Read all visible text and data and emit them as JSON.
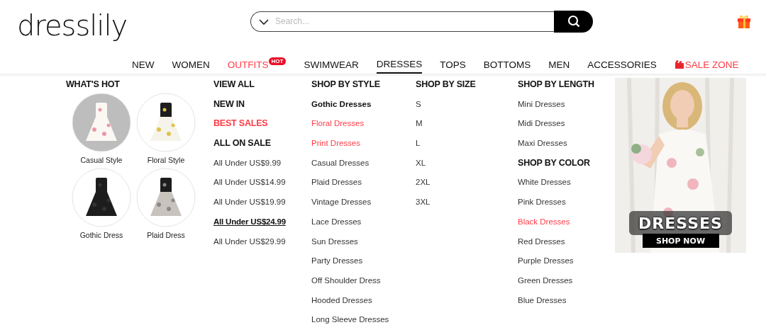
{
  "header": {
    "logo": "dresslily",
    "search": {
      "placeholder": "Search..."
    }
  },
  "nav": [
    {
      "label": "NEW",
      "kind": "plain",
      "selected": false
    },
    {
      "label": "WOMEN",
      "kind": "plain",
      "selected": false
    },
    {
      "label": "OUTFITS",
      "kind": "hot",
      "badge": "HOT",
      "selected": false
    },
    {
      "label": "SWIMWEAR",
      "kind": "plain",
      "selected": false
    },
    {
      "label": "DRESSES",
      "kind": "plain",
      "selected": true
    },
    {
      "label": "TOPS",
      "kind": "plain",
      "selected": false
    },
    {
      "label": "BOTTOMS",
      "kind": "plain",
      "selected": false
    },
    {
      "label": "MEN",
      "kind": "plain",
      "selected": false
    },
    {
      "label": "ACCESSORIES",
      "kind": "plain",
      "selected": false
    },
    {
      "label": "SALE ZONE",
      "kind": "sale",
      "selected": false
    }
  ],
  "whats_hot": {
    "title": "WHAT'S HOT",
    "items": [
      {
        "caption": "Casual Style",
        "kind": "picture"
      },
      {
        "caption": "Floral Style",
        "kind": "picture"
      },
      {
        "caption": "Gothic Dress",
        "kind": "picture"
      },
      {
        "caption": "Plaid Dress",
        "kind": "picture"
      }
    ]
  },
  "columns": [
    {
      "groups": [
        {
          "links": [
            {
              "label": "VIEW ALL",
              "kind": "heading"
            },
            {
              "label": "NEW IN",
              "kind": "heading"
            },
            {
              "label": "BEST SALES",
              "kind": "heading-red"
            },
            {
              "label": "ALL ON SALE",
              "kind": "heading"
            },
            {
              "label": "All Under US$9.99",
              "kind": "normal"
            },
            {
              "label": "All Under US$14.99",
              "kind": "normal"
            },
            {
              "label": "All Under US$19.99",
              "kind": "normal"
            },
            {
              "label": "All Under US$24.99",
              "kind": "underline"
            },
            {
              "label": "All Under US$29.99",
              "kind": "normal"
            }
          ]
        }
      ]
    },
    {
      "groups": [
        {
          "title": "SHOP BY STYLE",
          "links": [
            {
              "label": "Gothic Dresses",
              "kind": "bold"
            },
            {
              "label": "Floral Dresses",
              "kind": "red"
            },
            {
              "label": "Print Dresses",
              "kind": "red"
            },
            {
              "label": "Casual Dresses",
              "kind": "normal"
            },
            {
              "label": "Plaid Dresses",
              "kind": "normal"
            },
            {
              "label": "Vintage Dresses",
              "kind": "normal"
            },
            {
              "label": "Lace Dresses",
              "kind": "normal"
            },
            {
              "label": "Sun Dresses",
              "kind": "normal"
            },
            {
              "label": "Party Dresses",
              "kind": "normal"
            },
            {
              "label": "Off Shoulder Dress",
              "kind": "normal"
            },
            {
              "label": "Hooded Dresses",
              "kind": "normal"
            },
            {
              "label": "Long Sleeve Dresses",
              "kind": "normal"
            }
          ]
        }
      ]
    },
    {
      "groups": [
        {
          "title": "SHOP BY SIZE",
          "links": [
            {
              "label": "S",
              "kind": "normal"
            },
            {
              "label": "M",
              "kind": "normal"
            },
            {
              "label": "L",
              "kind": "normal"
            },
            {
              "label": "XL",
              "kind": "normal"
            },
            {
              "label": "2XL",
              "kind": "normal"
            },
            {
              "label": "3XL",
              "kind": "normal"
            }
          ]
        }
      ]
    },
    {
      "groups": [
        {
          "title": "SHOP BY LENGTH",
          "links": [
            {
              "label": "Mini Dresses",
              "kind": "normal"
            },
            {
              "label": "Midi Dresses",
              "kind": "normal"
            },
            {
              "label": "Maxi Dresses",
              "kind": "normal"
            }
          ]
        },
        {
          "title": "SHOP BY COLOR",
          "links": [
            {
              "label": "White Dresses",
              "kind": "normal"
            },
            {
              "label": "Pink Dresses",
              "kind": "normal"
            },
            {
              "label": "Black Dresses",
              "kind": "red"
            },
            {
              "label": "Red Dresses",
              "kind": "normal"
            },
            {
              "label": "Purple Dresses",
              "kind": "normal"
            },
            {
              "label": "Green Dresses",
              "kind": "normal"
            },
            {
              "label": "Blue Dresses",
              "kind": "normal"
            }
          ]
        }
      ]
    }
  ],
  "banner": {
    "kind": "picture",
    "headline": "DRESSES",
    "button": "SHOP NOW"
  }
}
